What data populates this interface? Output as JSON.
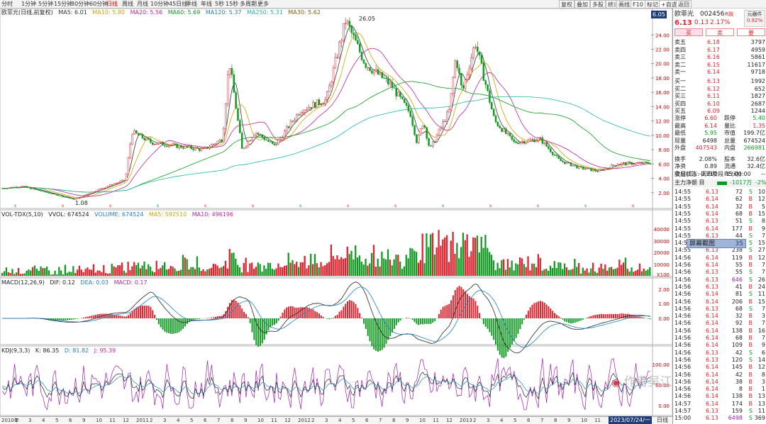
{
  "toolbar": {
    "periods": [
      "分时",
      "1分钟",
      "5分钟",
      "15分钟",
      "30分钟",
      "60分钟",
      "日线",
      "周线",
      "月线",
      "10分钟",
      "45日线",
      "季线",
      "年线",
      "5秒",
      "15秒",
      "多周期",
      "更多"
    ],
    "active_period": "日线",
    "right_buttons": [
      "复权",
      "叠加",
      "多股",
      "统计",
      "画线",
      "F10",
      "标记",
      "+自选",
      "返回"
    ]
  },
  "legend": {
    "main": {
      "name": "欧菲光(日线,前复权)",
      "ma5": "MA5: 6.01",
      "ma10": "MA10: 5.80",
      "ma20": "MA20: 5.56",
      "ma60": "MA60: 5.69",
      "ma120": "MA120: 5.37",
      "ma250": "MA250: 5.31",
      "ma30": "MA30: 5.62"
    },
    "vol": {
      "name": "VOL-TDX(5,10)",
      "vvol": "VVOL: 674524",
      "volume": "VOLUME: 674524",
      "ma5": "MA5: 592510",
      "ma10": "MA10: 496196"
    },
    "macd": {
      "name": "MACD(12,26,9)",
      "dif": "DIF: 0.12",
      "dea": "DEA: 0.03",
      "macd": "MACD: 0.17"
    },
    "kdj": {
      "name": "KDJ(9,3,3)",
      "k": "K: 86.35",
      "d": "D: 81.82",
      "j": "J: 95.39"
    }
  },
  "chart_annotations": {
    "high": "26.05",
    "low": "1.08",
    "current_tag": "6.05",
    "date_tag": "2023/07/24/一",
    "axis_mode": "日线"
  },
  "chart_data": [
    {
      "type": "candlestick",
      "title": "欧菲光(日线,前复权)",
      "y_ticks": [
        "24.00",
        "22.00",
        "20.00",
        "18.00",
        "16.00",
        "14.00",
        "12.00",
        "10.00",
        "8.00",
        "6.00",
        "4.00",
        "2.00"
      ],
      "ylim": [
        0,
        26.5
      ],
      "price_path": [
        [
          0,
          2.6
        ],
        [
          0.03,
          2.9
        ],
        [
          0.07,
          2.0
        ],
        [
          0.11,
          1.08
        ],
        [
          0.15,
          2.5
        ],
        [
          0.19,
          3.8
        ],
        [
          0.2,
          10.5
        ],
        [
          0.23,
          9.0
        ],
        [
          0.27,
          8.5
        ],
        [
          0.31,
          8.0
        ],
        [
          0.34,
          9.5
        ],
        [
          0.35,
          20.5
        ],
        [
          0.37,
          8.0
        ],
        [
          0.39,
          10.5
        ],
        [
          0.42,
          8.5
        ],
        [
          0.46,
          13.5
        ],
        [
          0.5,
          15.0
        ],
        [
          0.53,
          26.05
        ],
        [
          0.56,
          20.0
        ],
        [
          0.6,
          17.0
        ],
        [
          0.63,
          13.0
        ],
        [
          0.64,
          9.0
        ],
        [
          0.65,
          12.0
        ],
        [
          0.66,
          8.0
        ],
        [
          0.69,
          13.5
        ],
        [
          0.7,
          21.0
        ],
        [
          0.71,
          16.0
        ],
        [
          0.73,
          23.0
        ],
        [
          0.76,
          12.0
        ],
        [
          0.79,
          9.0
        ],
        [
          0.83,
          9.5
        ],
        [
          0.86,
          6.5
        ],
        [
          0.89,
          5.5
        ],
        [
          0.92,
          5.0
        ],
        [
          0.95,
          6.05
        ],
        [
          1.0,
          6.13
        ]
      ]
    },
    {
      "type": "bar",
      "title": "VOL-TDX(5,10)",
      "y_ticks": [
        "40000",
        "30000",
        "20000",
        "10000",
        "X100"
      ]
    },
    {
      "type": "line",
      "title": "MACD(12,26,9)",
      "y_ticks": [
        "2.00",
        "1.00",
        "0.00"
      ]
    },
    {
      "type": "line",
      "title": "KDJ(9,3,3)",
      "y_ticks": [
        "100.00",
        "50.00",
        "0.00"
      ]
    }
  ],
  "xaxis": [
    "2010年",
    "2",
    "3",
    "4",
    "5",
    "6",
    "9",
    "10",
    "11",
    "12",
    "2011",
    "2",
    "3",
    "4",
    "5",
    "6",
    "7",
    "8",
    "9",
    "10",
    "11",
    "12",
    "2012",
    "2",
    "3",
    "4",
    "5",
    "6",
    "7",
    "8",
    "9",
    "10",
    "11",
    "12",
    "2013",
    "2",
    "3",
    "4",
    "5",
    "6",
    "7",
    "8",
    "9",
    "10",
    "11",
    "12"
  ],
  "quote": {
    "name": "欧菲光",
    "code": "002456",
    "flag": "R融",
    "price": "6.13",
    "change": "0.13",
    "pct": "2.17%",
    "badge1": "元器件",
    "badge2": "0.92%",
    "tabs": [
      "买",
      "卖",
      "要"
    ]
  },
  "asks": [
    [
      "卖五",
      "6.18",
      "3797"
    ],
    [
      "卖四",
      "6.17",
      "4959"
    ],
    [
      "卖三",
      "6.16",
      "5861"
    ],
    [
      "卖二",
      "6.15",
      "11617"
    ],
    [
      "卖一",
      "6.14",
      "9718"
    ]
  ],
  "bids": [
    [
      "买一",
      "6.13",
      "1992"
    ],
    [
      "买二",
      "6.12",
      "652"
    ],
    [
      "买三",
      "6.11",
      "1827"
    ],
    [
      "买四",
      "6.10",
      "2687"
    ],
    [
      "买五",
      "6.09",
      "1244"
    ]
  ],
  "stats": [
    [
      "涨停",
      "6.60",
      "跌停",
      "5.40"
    ],
    [
      "最高",
      "6.14",
      "量比",
      "1.35"
    ],
    [
      "最低",
      "5.95",
      "市值",
      "199.7亿"
    ],
    [
      "现量",
      "6498",
      "总量",
      "674524"
    ],
    [
      "外盘",
      "407543",
      "内盘",
      "266981"
    ],
    [
      "换手",
      "2.08%",
      "股本",
      "32.6亿"
    ],
    [
      "净资",
      "0.89",
      "流通",
      "32.4亿"
    ],
    [
      "收益(三)",
      "-0.110",
      "PE(动)",
      "--"
    ]
  ],
  "trade_status": "交易状态: 闭市阶段 15:00:00",
  "capital_flow": {
    "label": "主力净额 目",
    "value": "-1017万",
    "pct": "-2%"
  },
  "ticks": [
    [
      "14:55",
      "6.13",
      "72",
      "S",
      "10"
    ],
    [
      "14:55",
      "6.14",
      "62",
      "B",
      "12"
    ],
    [
      "14:55",
      "6.14",
      "32",
      "B",
      "5"
    ],
    [
      "14:55",
      "6.14",
      "68",
      "B",
      "15"
    ],
    [
      "14:55",
      "6.13",
      "51",
      "S",
      "8"
    ],
    [
      "14:55",
      "6.14",
      "177",
      "B",
      "9"
    ],
    [
      "14:55",
      "6.13",
      "44",
      "S",
      "7"
    ],
    [
      "14:55",
      "6.14",
      "174",
      "S",
      "15"
    ],
    [
      "14:55",
      "6.13",
      "238",
      "S",
      "27"
    ],
    [
      "14:56",
      "6.14",
      "119",
      "B",
      "12"
    ],
    [
      "14:56",
      "6.14",
      "55",
      "B",
      "7"
    ],
    [
      "14:56",
      "6.13",
      "55",
      "S",
      "7"
    ],
    [
      "14:56",
      "6.13",
      "646",
      "S",
      "26"
    ],
    [
      "14:56",
      "6.13",
      "41",
      "B",
      "24"
    ],
    [
      "14:56",
      "6.14",
      "81",
      "S",
      "11"
    ],
    [
      "14:56",
      "6.14",
      "206",
      "B",
      "15"
    ],
    [
      "14:56",
      "6.13",
      "68",
      "S",
      "7"
    ],
    [
      "14:56",
      "6.14",
      "32",
      "B",
      "3"
    ],
    [
      "14:56",
      "6.14",
      "92",
      "B",
      "7"
    ],
    [
      "14:56",
      "6.14",
      "138",
      "B",
      "16"
    ],
    [
      "14:56",
      "6.14",
      "68",
      "B",
      "7"
    ],
    [
      "14:56",
      "6.14",
      "109",
      "B",
      "9"
    ],
    [
      "14:56",
      "6.13",
      "42",
      "S",
      "6"
    ],
    [
      "14:56",
      "6.13",
      "120",
      "S",
      "14"
    ],
    [
      "14:56",
      "6.14",
      "145",
      "B",
      "12"
    ],
    [
      "14:56",
      "6.14",
      "42",
      "B",
      "8"
    ],
    [
      "14:56",
      "6.14",
      "38",
      "B",
      "3"
    ],
    [
      "14:56",
      "6.14",
      "8",
      "B",
      "1"
    ],
    [
      "14:56",
      "6.14",
      "138",
      "B",
      "13"
    ],
    [
      "14:57",
      "6.14",
      "174",
      "B",
      "13"
    ],
    [
      "14:57",
      "6.13",
      "159",
      "S",
      "11"
    ],
    [
      "15:00",
      "6.13",
      "6498",
      "S",
      "369"
    ]
  ],
  "screenshot_overlay": {
    "label": "屏幕截图",
    "key": "35"
  },
  "watermark": "作者吴江"
}
